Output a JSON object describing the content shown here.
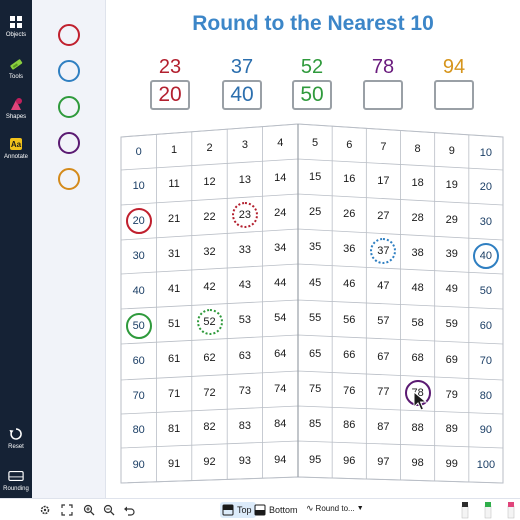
{
  "sidebar": {
    "tools": [
      {
        "label": "Objects",
        "icon": "objects-icon"
      },
      {
        "label": "Tools",
        "icon": "tools-icon"
      },
      {
        "label": "Shapes",
        "icon": "shapes-icon"
      },
      {
        "label": "Annotate",
        "icon": "annotate-icon"
      }
    ],
    "bottom_tools": [
      {
        "label": "Reset",
        "icon": "reset-icon"
      },
      {
        "label": "Rounding",
        "icon": "rounding-icon"
      }
    ]
  },
  "palette": {
    "circle_colors": [
      "#c0202e",
      "#2f7fc1",
      "#2f9a3c",
      "#5a1a72",
      "#d48a1b"
    ]
  },
  "title": "Round to the Nearest 10",
  "targets": [
    {
      "number": "23",
      "answer": "20",
      "color": "#b3202f"
    },
    {
      "number": "37",
      "answer": "40",
      "color": "#2c6fae"
    },
    {
      "number": "52",
      "answer": "50",
      "color": "#2f9a3c"
    },
    {
      "number": "78",
      "answer": "",
      "color": "#6a1b7e"
    },
    {
      "number": "94",
      "answer": "",
      "color": "#d6951c"
    }
  ],
  "board": {
    "rows": [
      [
        "0",
        "1",
        "2",
        "3",
        "4",
        "5",
        "6",
        "7",
        "8",
        "9",
        "10"
      ],
      [
        "10",
        "11",
        "12",
        "13",
        "14",
        "15",
        "16",
        "17",
        "18",
        "19",
        "20"
      ],
      [
        "20",
        "21",
        "22",
        "23",
        "24",
        "25",
        "26",
        "27",
        "28",
        "29",
        "30"
      ],
      [
        "30",
        "31",
        "32",
        "33",
        "34",
        "35",
        "36",
        "37",
        "38",
        "39",
        "40"
      ],
      [
        "40",
        "41",
        "42",
        "43",
        "44",
        "45",
        "46",
        "47",
        "48",
        "49",
        "50"
      ],
      [
        "50",
        "51",
        "52",
        "53",
        "54",
        "55",
        "56",
        "57",
        "58",
        "59",
        "60"
      ],
      [
        "60",
        "61",
        "62",
        "63",
        "64",
        "65",
        "66",
        "67",
        "68",
        "69",
        "70"
      ],
      [
        "70",
        "71",
        "72",
        "73",
        "74",
        "75",
        "76",
        "77",
        "78",
        "79",
        "80"
      ],
      [
        "80",
        "81",
        "82",
        "83",
        "84",
        "85",
        "86",
        "87",
        "88",
        "89",
        "90"
      ],
      [
        "90",
        "91",
        "92",
        "93",
        "94",
        "95",
        "96",
        "97",
        "98",
        "99",
        "100"
      ]
    ],
    "marked": [
      {
        "value": "20",
        "row": 2,
        "col": 0,
        "style": "solid",
        "color": "#c0202e"
      },
      {
        "value": "23",
        "row": 2,
        "col": 3,
        "style": "dotted",
        "color": "#b3202f"
      },
      {
        "value": "37",
        "row": 3,
        "col": 7,
        "style": "dotted",
        "color": "#2f7fc1"
      },
      {
        "value": "40",
        "row": 3,
        "col": 10,
        "style": "solid",
        "color": "#2f7fc1"
      },
      {
        "value": "50",
        "row": 5,
        "col": 0,
        "style": "solid",
        "color": "#2f9a3c"
      },
      {
        "value": "52",
        "row": 5,
        "col": 2,
        "style": "dotted",
        "color": "#2f9a3c"
      },
      {
        "value": "78",
        "row": 7,
        "col": 8,
        "style": "solid",
        "color": "#5a1a72"
      }
    ]
  },
  "bottombar": {
    "top_label": "Top",
    "bottom_label": "Bottom",
    "dropdown_label": "Round to...",
    "pen_colors": [
      "#2b2b2b",
      "#2fae4a",
      "#e0457b"
    ]
  }
}
